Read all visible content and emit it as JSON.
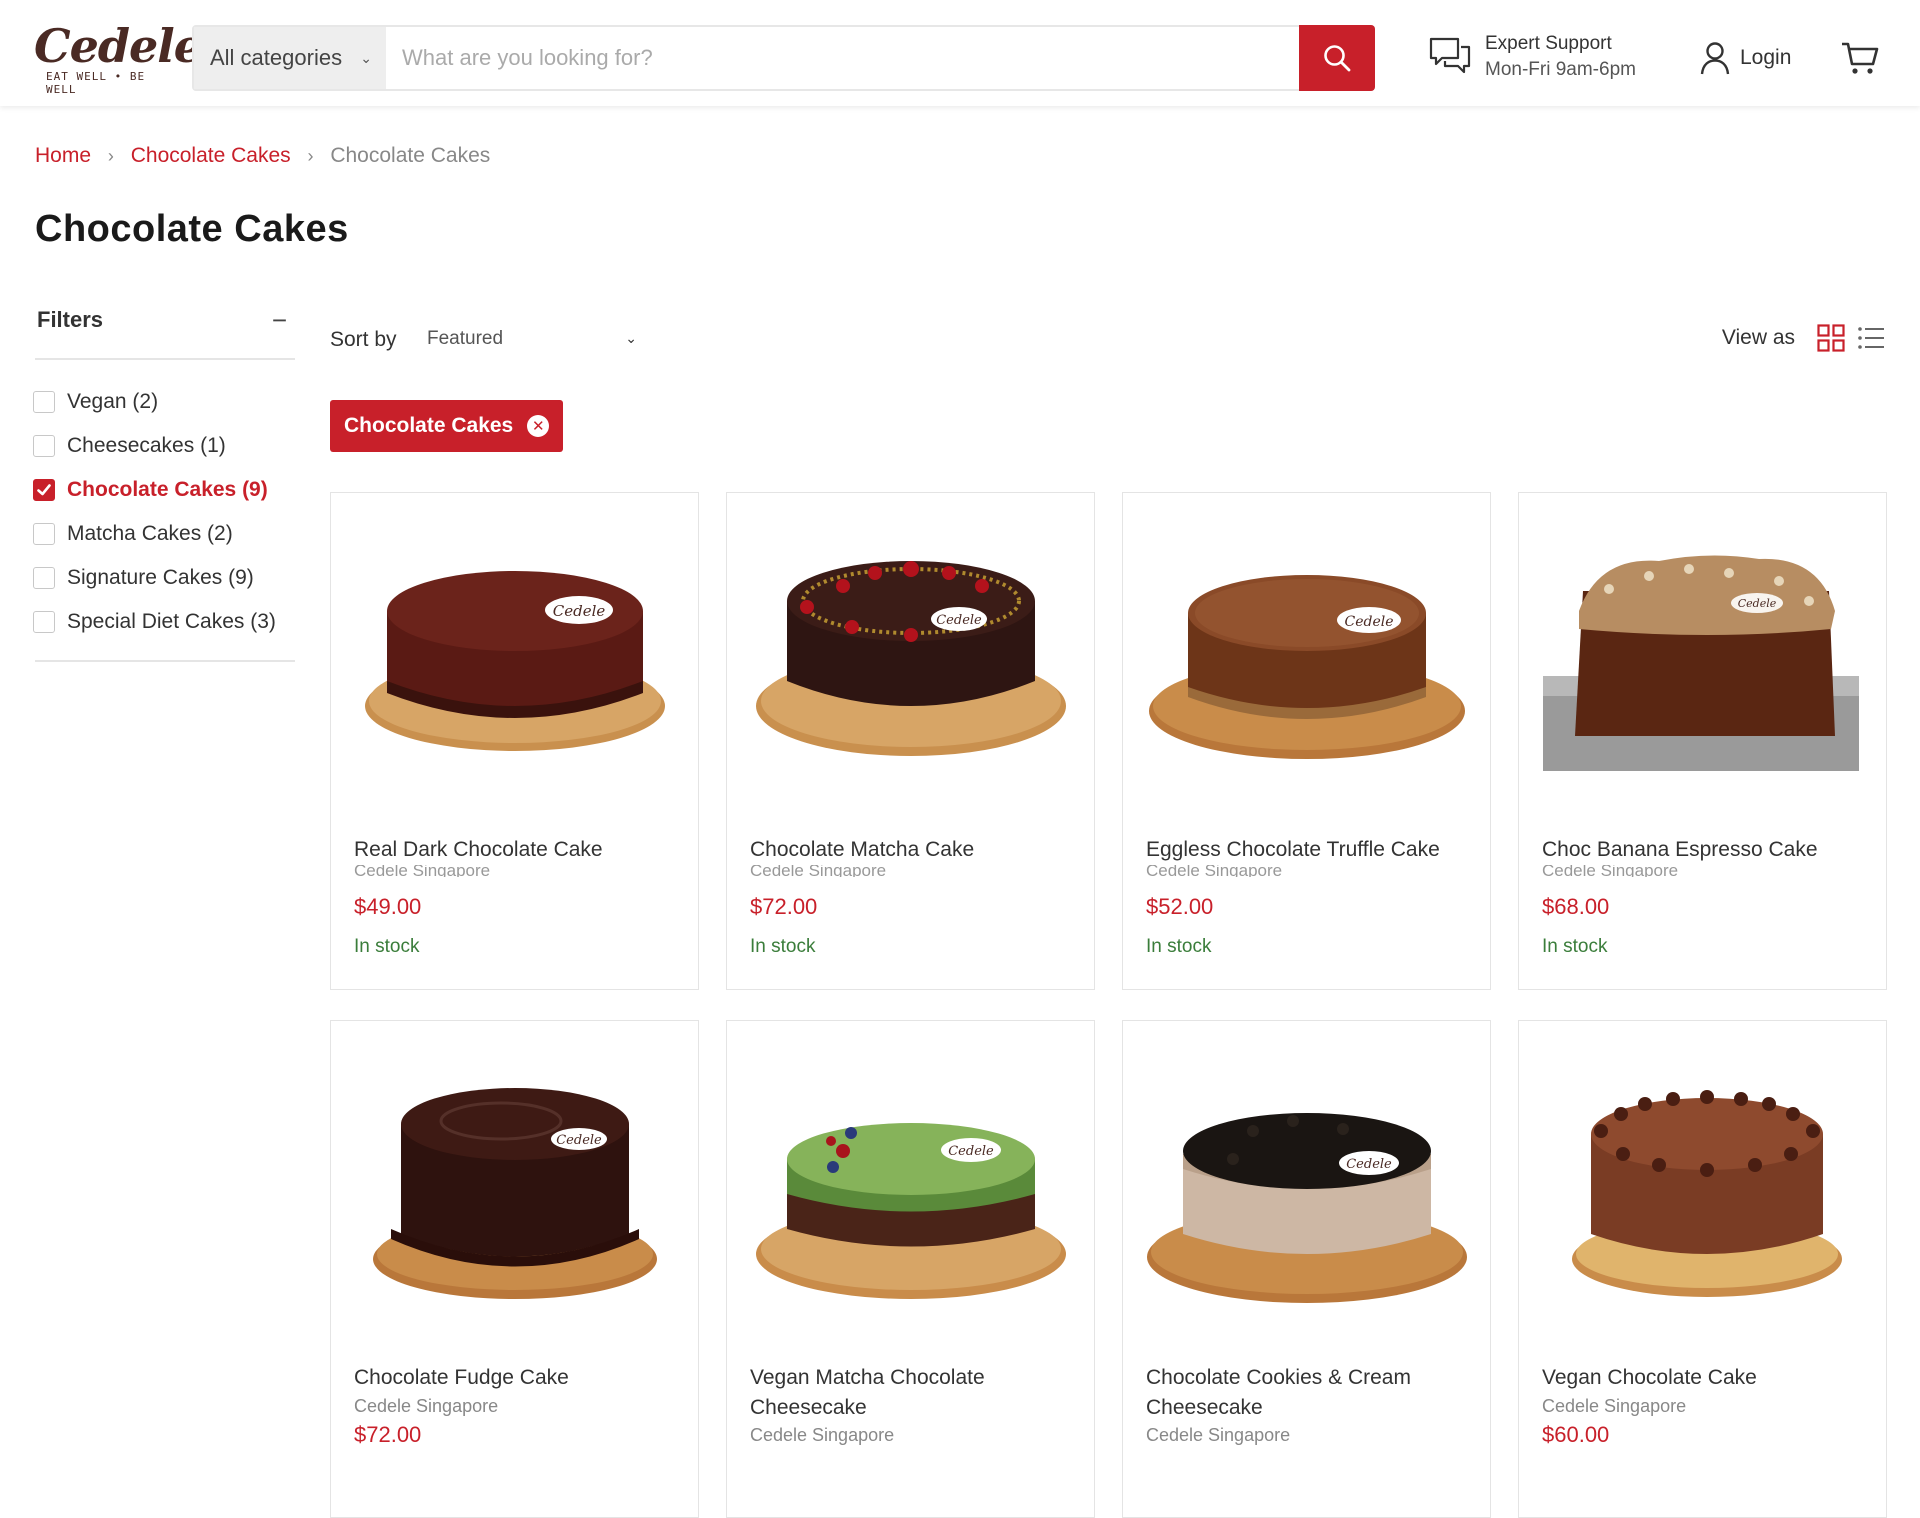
{
  "header": {
    "logo_text": "Cedele",
    "logo_tagline": "EAT WELL • BE WELL",
    "search_category": "All categories",
    "search_placeholder": "What are you looking for?",
    "support_title": "Expert Support",
    "support_hours": "Mon-Fri 9am-6pm",
    "login_label": "Login"
  },
  "breadcrumb": {
    "items": [
      "Home",
      "Chocolate Cakes",
      "Chocolate Cakes"
    ]
  },
  "page": {
    "title": "Chocolate Cakes"
  },
  "filters": {
    "title": "Filters",
    "toggle": "−",
    "items": [
      {
        "label": "Vegan (2)",
        "checked": false
      },
      {
        "label": "Cheesecakes (1)",
        "checked": false
      },
      {
        "label": "Chocolate Cakes (9)",
        "checked": true
      },
      {
        "label": "Matcha Cakes (2)",
        "checked": false
      },
      {
        "label": "Signature Cakes (9)",
        "checked": false
      },
      {
        "label": "Special Diet Cakes (3)",
        "checked": false
      }
    ]
  },
  "toolbar": {
    "sort_label": "Sort by",
    "sort_value": "Featured",
    "view_label": "View as"
  },
  "active_filter": {
    "label": "Chocolate Cakes"
  },
  "products": [
    {
      "title": "Real Dark Chocolate Cake",
      "vendor": "Cedele Singapore",
      "price": "$49.00",
      "stock": "In stock"
    },
    {
      "title": "Chocolate Matcha Cake",
      "vendor": "Cedele Singapore",
      "price": "$72.00",
      "stock": "In stock"
    },
    {
      "title": "Eggless Chocolate Truffle Cake",
      "vendor": "Cedele Singapore",
      "price": "$52.00",
      "stock": "In stock"
    },
    {
      "title": "Choc Banana Espresso Cake",
      "vendor": "Cedele Singapore",
      "price": "$68.00",
      "stock": "In stock"
    },
    {
      "title": "Chocolate Fudge Cake",
      "vendor": "Cedele Singapore",
      "price": "$72.00",
      "stock": ""
    },
    {
      "title": "Vegan Matcha Chocolate Cheesecake",
      "vendor": "Cedele Singapore",
      "price": "",
      "stock": ""
    },
    {
      "title": "Chocolate Cookies & Cream Cheesecake",
      "vendor": "Cedele Singapore",
      "price": "",
      "stock": ""
    },
    {
      "title": "Vegan Chocolate Cake",
      "vendor": "Cedele Singapore",
      "price": "$60.00",
      "stock": ""
    }
  ],
  "colors": {
    "brand_red": "#c8202a",
    "stock_green": "#3a7d3a",
    "logo_brown": "#4a2a24"
  }
}
